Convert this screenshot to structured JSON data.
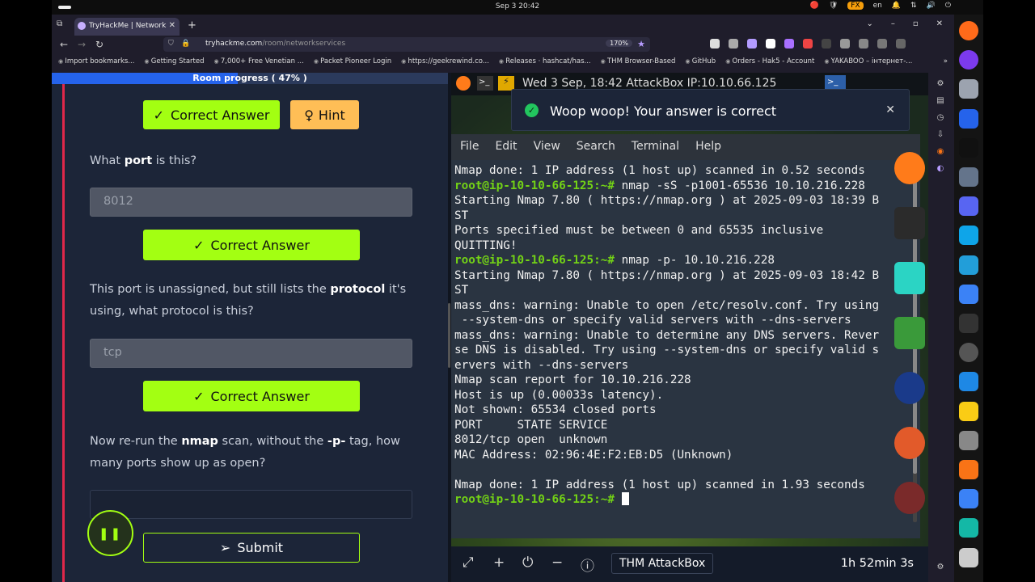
{
  "os": {
    "clock": "Sep 3  20:42",
    "tray": [
      "🔴",
      "🛡",
      "FX",
      "en",
      "🔔",
      "⇅",
      "🔊",
      "⏻"
    ]
  },
  "browser": {
    "tab_title": "TryHackMe | Network",
    "url_host": "tryhackme.com",
    "url_path": "/room/networkservices",
    "zoom": "170%",
    "window_controls": [
      "⌄",
      "–",
      "▫",
      "✕"
    ],
    "bookmarks": [
      "Import bookmarks...",
      "Getting Started",
      "7,000+ Free Venetian ...",
      "Packet Pioneer Login",
      "https://geekrewind.co...",
      "Releases · hashcat/has...",
      "THM Browser-Based",
      "GitHub",
      "Orders - Hak5 - Account",
      "YAKABOO – інтернет-..."
    ],
    "ext_colors": [
      "#ddd",
      "#aaa",
      "#b39cff",
      "#fff",
      "#a970ff",
      "#e44",
      "#444",
      "#999",
      "#888",
      "#777",
      "#666"
    ]
  },
  "room": {
    "progress_label": "Room progress ( 47% )",
    "progress_value": 47,
    "correct_label": "Correct Answer",
    "hint_label": "Hint",
    "submit_label": "Submit",
    "q1_pre": "What ",
    "q1_bold": "port",
    "q1_post": " is this?",
    "a1": "8012",
    "q2_pre": "This port is unassigned, but still lists the ",
    "q2_bold": "protocol",
    "q2_post": " it's using, what protocol is this?",
    "a2": "tcp",
    "q3_pre": "Now re-run the ",
    "q3_bold1": "nmap",
    "q3_mid": " scan, without the ",
    "q3_bold2": "-p-",
    "q3_post": " tag, how many ports show up as open?"
  },
  "toast": {
    "message": "Woop woop! Your answer is correct"
  },
  "attackbox": {
    "topbar_info": "Wed 3 Sep, 18:42 AttackBox IP:10.10.66.125",
    "menu": [
      "File",
      "Edit",
      "View",
      "Search",
      "Terminal",
      "Help"
    ],
    "terminal_lines": [
      {
        "p": "",
        "t": "Nmap done: 1 IP address (1 host up) scanned in 0.52 seconds"
      },
      {
        "p": "root@ip-10-10-66-125:~# ",
        "t": "nmap -sS -p1001-65536 10.10.216.228"
      },
      {
        "p": "",
        "t": "Starting Nmap 7.80 ( https://nmap.org ) at 2025-09-03 18:39 B"
      },
      {
        "p": "",
        "t": "ST"
      },
      {
        "p": "",
        "t": "Ports specified must be between 0 and 65535 inclusive"
      },
      {
        "p": "",
        "t": "QUITTING!"
      },
      {
        "p": "root@ip-10-10-66-125:~# ",
        "t": "nmap -p- 10.10.216.228"
      },
      {
        "p": "",
        "t": "Starting Nmap 7.80 ( https://nmap.org ) at 2025-09-03 18:42 B"
      },
      {
        "p": "",
        "t": "ST"
      },
      {
        "p": "",
        "t": "mass_dns: warning: Unable to open /etc/resolv.conf. Try using"
      },
      {
        "p": "",
        "t": " --system-dns or specify valid servers with --dns-servers"
      },
      {
        "p": "",
        "t": "mass_dns: warning: Unable to determine any DNS servers. Rever"
      },
      {
        "p": "",
        "t": "se DNS is disabled. Try using --system-dns or specify valid s"
      },
      {
        "p": "",
        "t": "ervers with --dns-servers"
      },
      {
        "p": "",
        "t": "Nmap scan report for 10.10.216.228"
      },
      {
        "p": "",
        "t": "Host is up (0.00033s latency)."
      },
      {
        "p": "",
        "t": "Not shown: 65534 closed ports"
      },
      {
        "p": "",
        "t": "PORT     STATE SERVICE"
      },
      {
        "p": "",
        "t": "8012/tcp open  unknown"
      },
      {
        "p": "",
        "t": "MAC Address: 02:96:4E:F2:EB:D5 (Unknown)"
      },
      {
        "p": "",
        "t": ""
      },
      {
        "p": "",
        "t": "Nmap done: 1 IP address (1 host up) scanned in 1.93 seconds"
      },
      {
        "p": "root@ip-10-10-66-125:~# ",
        "t": "",
        "cursor": true
      }
    ],
    "bottom_label": "THM AttackBox",
    "timer": "1h 52min 3s",
    "dock_colors": [
      "#ff7b1a",
      "#2b2b2b",
      "#2bd4c4",
      "#3a9a3a",
      "#1a3a8a",
      "#e25a2a",
      "#7a2a2a"
    ]
  },
  "os_dock_colors": [
    "#ff6a1a",
    "#7c3aed",
    "#9ca3af",
    "#2563eb",
    "#111",
    "#64748b",
    "#5865f2",
    "#0ea5e9",
    "#229ed9",
    "#3b82f6",
    "#333",
    "#555",
    "#1e88e5",
    "#facc15",
    "#888",
    "#f97316",
    "#3b82f6",
    "#14b8a6",
    "#ccc"
  ]
}
